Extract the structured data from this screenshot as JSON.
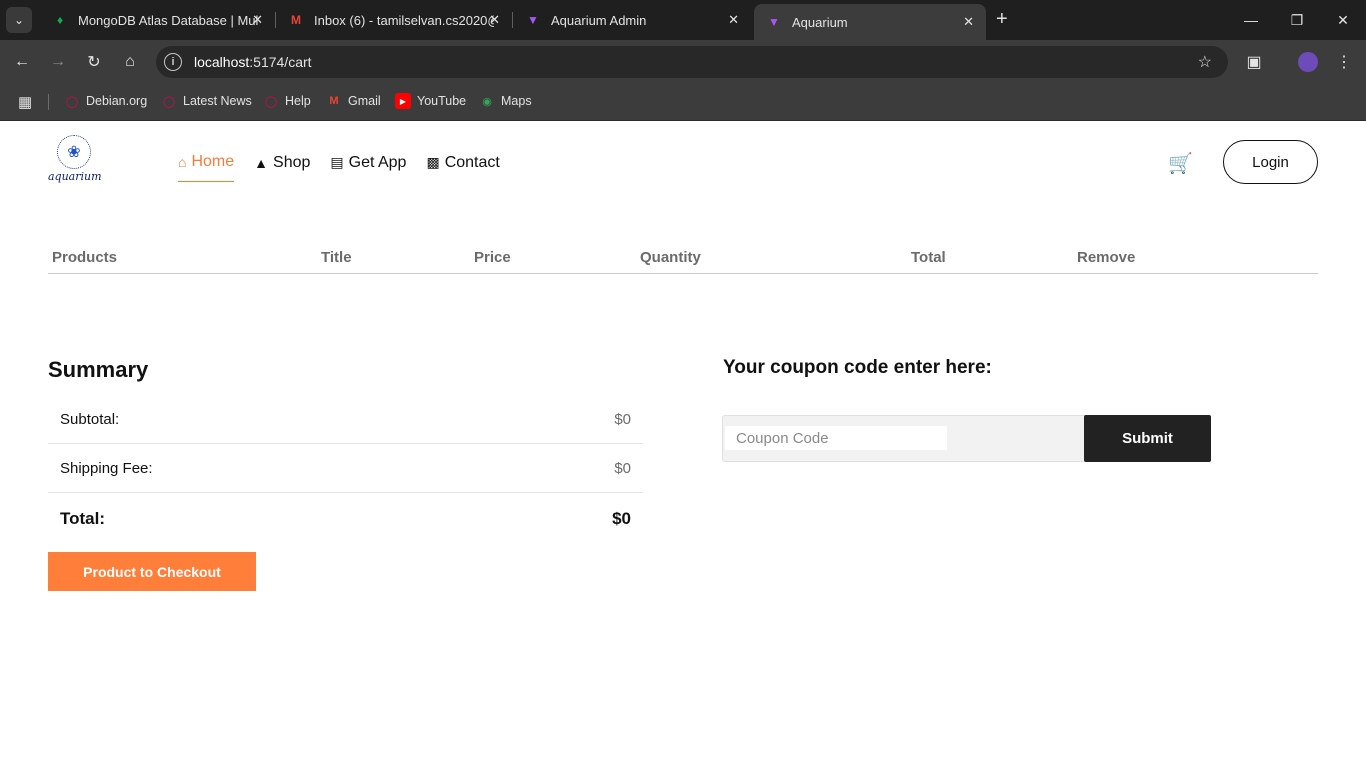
{
  "browser": {
    "tabs": [
      {
        "title": "MongoDB Atlas Database | Mul",
        "icon": "mongodb-leaf-icon"
      },
      {
        "title": "Inbox (6) - tamilselvan.cs2020@",
        "icon": "gmail-icon"
      },
      {
        "title": "Aquarium Admin",
        "icon": "vite-icon"
      },
      {
        "title": "Aquarium",
        "icon": "vite-icon",
        "active": true
      }
    ],
    "url_host": "localhost",
    "url_path": ":5174/cart",
    "bookmarks": [
      {
        "label": "Debian.org",
        "icon": "debian-icon"
      },
      {
        "label": "Latest News",
        "icon": "debian-icon"
      },
      {
        "label": "Help",
        "icon": "debian-icon"
      },
      {
        "label": "Gmail",
        "icon": "gmail-icon"
      },
      {
        "label": "YouTube",
        "icon": "youtube-icon"
      },
      {
        "label": "Maps",
        "icon": "maps-icon"
      }
    ]
  },
  "site": {
    "logo_text": "aquarium",
    "nav": [
      {
        "label": "Home",
        "icon": "home-icon",
        "active": true
      },
      {
        "label": "Shop",
        "icon": "shapes-icon"
      },
      {
        "label": "Get App",
        "icon": "app-icon"
      },
      {
        "label": "Contact",
        "icon": "contact-icon"
      }
    ],
    "login_label": "Login",
    "accent_color": "#ff7f3a"
  },
  "cart": {
    "columns": [
      "Products",
      "Title",
      "Price",
      "Quantity",
      "Total",
      "Remove"
    ]
  },
  "summary": {
    "title": "Summary",
    "subtotal_label": "Subtotal:",
    "subtotal_value": "$0",
    "shipping_label": "Shipping Fee:",
    "shipping_value": "$0",
    "total_label": "Total:",
    "total_value": "$0",
    "checkout_label": "Product to Checkout"
  },
  "coupon": {
    "title": "Your coupon code enter here:",
    "placeholder": "Coupon Code",
    "value": "",
    "submit_label": "Submit"
  }
}
